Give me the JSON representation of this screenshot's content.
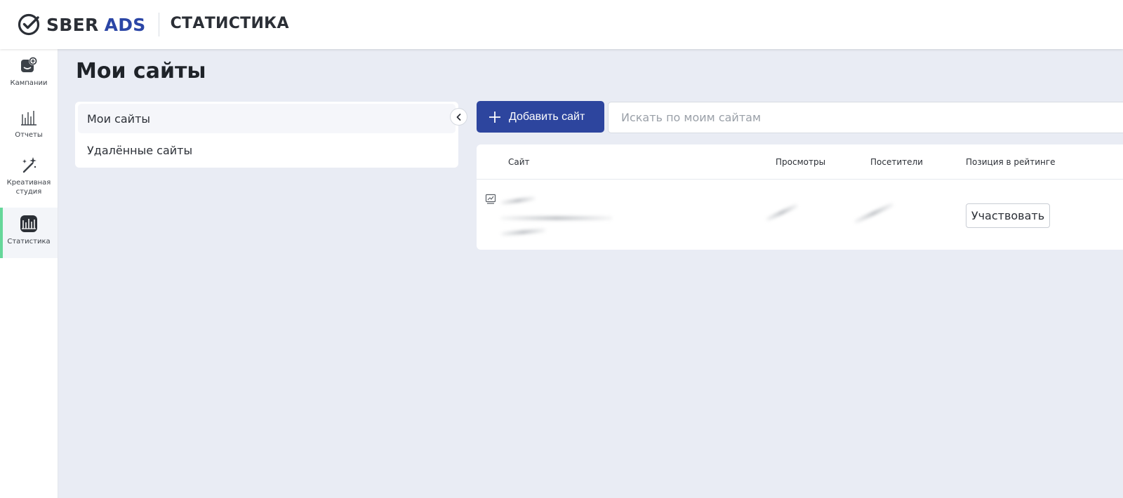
{
  "header": {
    "brand_sber": "SBER",
    "brand_ads": "ADS",
    "section": "СТАТИСТИКА",
    "brand_color": "#2b46a6"
  },
  "rail": {
    "items": [
      {
        "label": "Кампании",
        "icon": "campaigns-icon"
      },
      {
        "label": "Отчеты",
        "icon": "reports-chart-icon"
      },
      {
        "label": "Креативная студия",
        "icon": "sparkle-icon"
      },
      {
        "label": "Статистика",
        "icon": "statistics-icon",
        "active": true
      }
    ],
    "active_color": "#66d79a"
  },
  "page": {
    "title": "Мои сайты"
  },
  "submenu": {
    "items": [
      {
        "label": "Мои сайты",
        "active": true
      },
      {
        "label": "Удалённые сайты"
      }
    ]
  },
  "toolbar": {
    "add_label": "Добавить сайт",
    "search_placeholder": "Искать по моим сайтам",
    "accent": "#2d459e"
  },
  "table": {
    "columns": [
      "Сайт",
      "Просмотры",
      "Посетители",
      "Позиция в рейтинге"
    ],
    "rows": [
      {
        "action_label": "Участвовать"
      }
    ]
  }
}
